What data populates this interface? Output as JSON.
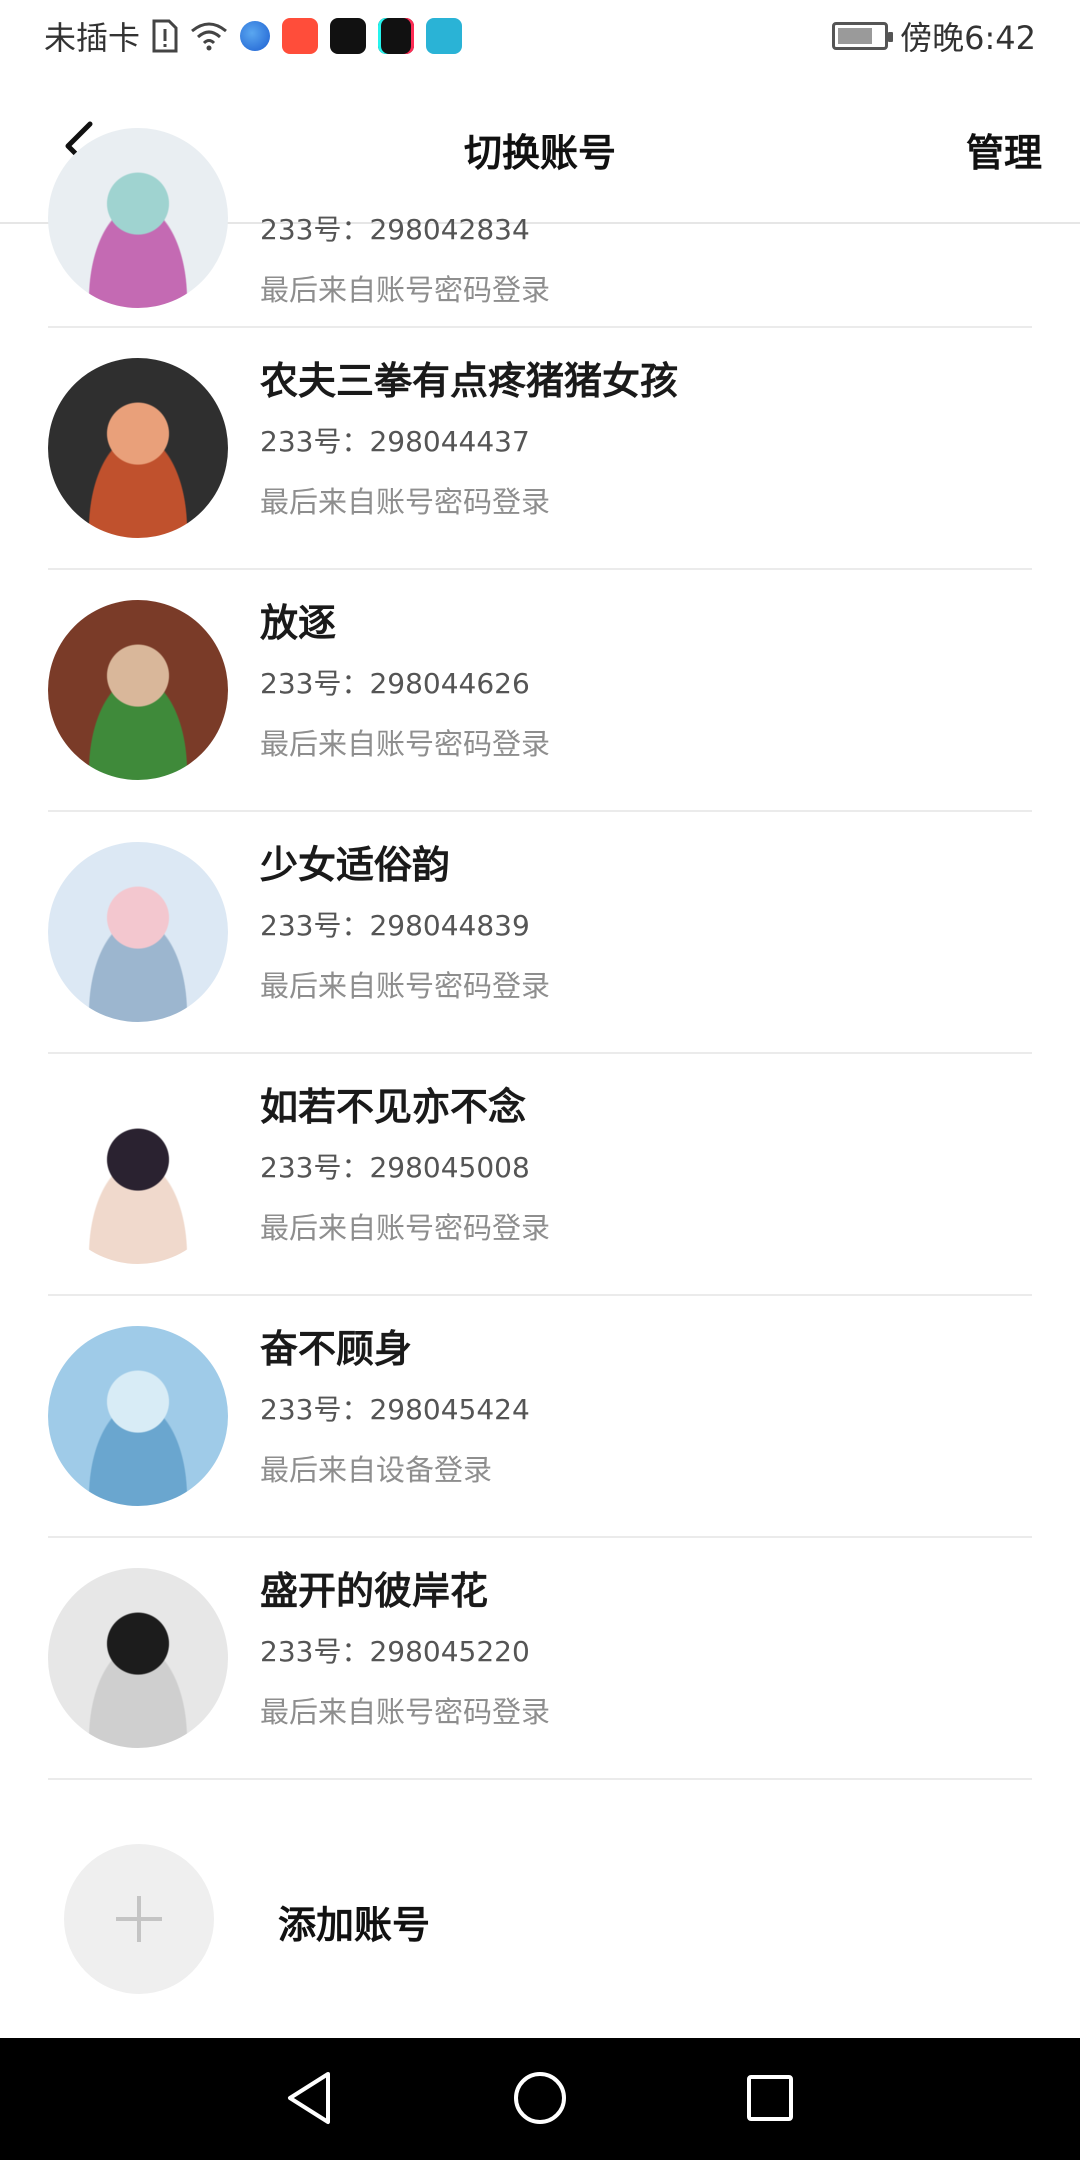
{
  "status_bar": {
    "carrier": "未插卡",
    "time": "傍晚6:42",
    "icons": [
      "sim-alert-icon",
      "wifi-icon",
      "browser-app-icon",
      "kuaishou-app-icon",
      "capcut-app-icon",
      "tiktok-app-icon",
      "reader-app-icon",
      "battery-icon"
    ]
  },
  "header": {
    "title": "切换账号",
    "manage_label": "管理",
    "back_icon": "chevron-left-icon"
  },
  "accounts": [
    {
      "name": "",
      "uid": "233号：298042834",
      "login": "最后来自账号密码登录",
      "avatar_colors": [
        "#e9eef2",
        "#9fd3d0",
        "#c46ab3"
      ]
    },
    {
      "name": "农夫三拳有点疼猪猪女孩",
      "uid": "233号：298044437",
      "login": "最后来自账号密码登录",
      "avatar_colors": [
        "#2f2f2f",
        "#e9a07a",
        "#c0512d"
      ]
    },
    {
      "name": "放逐",
      "uid": "233号：298044626",
      "login": "最后来自账号密码登录",
      "avatar_colors": [
        "#7a3b28",
        "#d9b79a",
        "#3f8a3a"
      ]
    },
    {
      "name": "少女适俗韵",
      "uid": "233号：298044839",
      "login": "最后来自账号密码登录",
      "avatar_colors": [
        "#dce8f4",
        "#f3c7cf",
        "#9cb6cf"
      ]
    },
    {
      "name": "如若不见亦不念",
      "uid": "233号：298045008",
      "login": "最后来自账号密码登录",
      "avatar_colors": [
        "#ffffff",
        "#2a2230",
        "#f0d9cc"
      ]
    },
    {
      "name": "奋不顾身",
      "uid": "233号：298045424",
      "login": "最后来自设备登录",
      "avatar_colors": [
        "#9fcbe8",
        "#d8ecf6",
        "#6aa6cf"
      ]
    },
    {
      "name": "盛开的彼岸花",
      "uid": "233号：298045220",
      "login": "最后来自账号密码登录",
      "avatar_colors": [
        "#e7e7e7",
        "#1c1c1c",
        "#cfcfcf"
      ]
    }
  ],
  "add_account": {
    "label": "添加账号",
    "icon": "plus-icon"
  },
  "nav_bar": {
    "icons": [
      "back-triangle-icon",
      "home-circle-icon",
      "recents-square-icon"
    ]
  },
  "colors": {
    "divider": "#ebebeb",
    "secondary_text": "#8e8e8e",
    "nav_bg": "#000000"
  }
}
